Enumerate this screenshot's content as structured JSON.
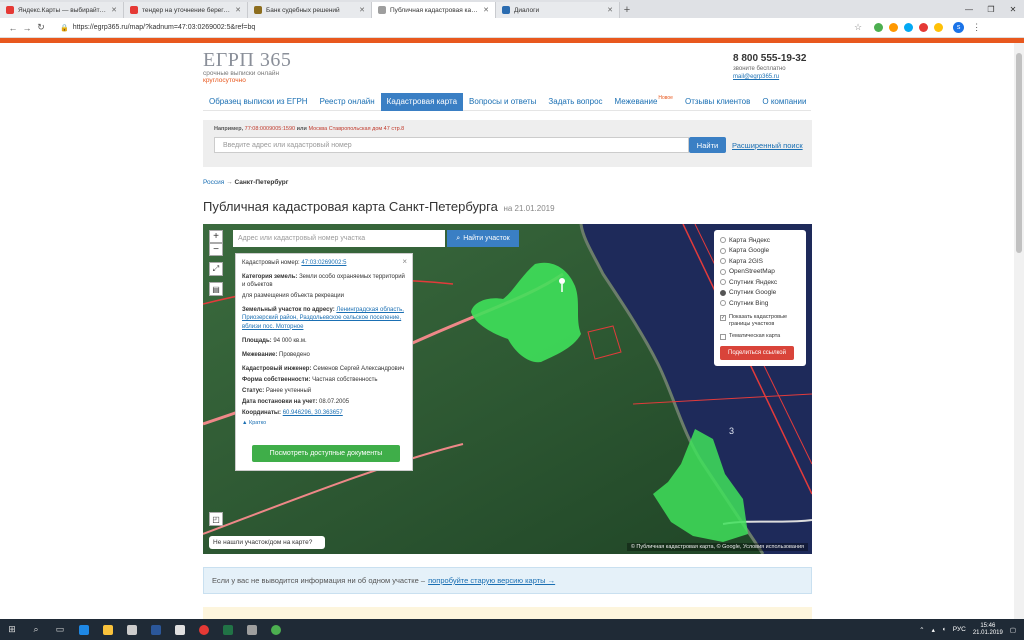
{
  "browser": {
    "tabs": [
      {
        "label": "Яндекс.Карты — выбирайте, где",
        "color": "#e53935",
        "active": false
      },
      {
        "label": "тендер на уточнение берегово",
        "color": "#e53935",
        "active": false
      },
      {
        "label": "Банк судебных решений",
        "color": "#8d6e1f",
        "active": false
      },
      {
        "label": "Публичная кадастровая карта",
        "color": "#9e9e9e",
        "active": true
      },
      {
        "label": "Диалоги",
        "color": "#2b6cb0",
        "active": false
      }
    ],
    "url": "https://egrp365.ru/map/?kadnum=47:03:0269002:5&ref=bq",
    "profile_initial": "s"
  },
  "header": {
    "logo_name": "ЕГРП 365",
    "logo_tag1": "срочные выписки онлайн",
    "logo_tag2": "круглосуточно",
    "phone": "8 800 555-19-32",
    "phone_note": "звоните бесплатно",
    "email": "mail@egrp365.ru"
  },
  "nav": {
    "items": [
      {
        "label": "Образец выписки из ЕГРН",
        "active": false,
        "badge": ""
      },
      {
        "label": "Реестр онлайн",
        "active": false,
        "badge": ""
      },
      {
        "label": "Кадастровая карта",
        "active": true,
        "badge": ""
      },
      {
        "label": "Вопросы и ответы",
        "active": false,
        "badge": ""
      },
      {
        "label": "Задать вопрос",
        "active": false,
        "badge": ""
      },
      {
        "label": "Межевание",
        "active": false,
        "badge": "Новое"
      },
      {
        "label": "Отзывы клиентов",
        "active": false,
        "badge": ""
      },
      {
        "label": "О компании",
        "active": false,
        "badge": ""
      }
    ]
  },
  "search": {
    "hint_prefix": "Например,",
    "hint_example1": "77:08:0009005:1590",
    "hint_or": "или",
    "hint_example2": "Москва Ставропольская дом 47 стр.8",
    "placeholder": "Введите адрес или кадастровый номер",
    "button": "Найти",
    "advanced": "Расширенный поиск"
  },
  "breadcrumb": {
    "root": "Россия",
    "sep": "→",
    "current": "Санкт-Петербург"
  },
  "page": {
    "title": "Публичная кадастровая карта Санкт-Петербурга",
    "date": "на 21.01.2019"
  },
  "map": {
    "search_placeholder": "Адрес или кадастровый номер участка",
    "search_button": "Найти участок",
    "zoom_in": "+",
    "zoom_out": "−",
    "not_found": "Не нашли участок/дом на карте?",
    "copyright": "© Публичная кадастровая карта, © Google, Условия использования",
    "label_3": "3",
    "info": {
      "cad_num_label": "Кадастровый номер:",
      "cad_num": "47:03:0269002:5",
      "category_label": "Категория земель:",
      "category": "Земли особо охраняемых территорий и объектов",
      "usage": "для размещения объекта рекреации",
      "address_label": "Земельный участок по адресу:",
      "address": "Ленинградская область, Приозерский район, Раздольевское сельское поселение, вблизи пос. Моторное",
      "area_label": "Площадь:",
      "area": "94 000 кв.м.",
      "survey_label": "Межевание:",
      "survey": "Проведено",
      "engineer_label": "Кадастровый инженер:",
      "engineer": "Семенов Сергей Александрович",
      "ownership_label": "Форма собственности:",
      "ownership": "Частная собственность",
      "status_label": "Статус:",
      "status": "Ранее учтенный",
      "reg_date_label": "Дата постановки на учет:",
      "reg_date": "08.07.2005",
      "coords_label": "Координаты:",
      "coords": "60.946296, 30.363657",
      "brief": "Кратко",
      "docs_button": "Посмотреть доступные документы"
    },
    "layers": {
      "options": [
        {
          "label": "Карта Яндекс",
          "selected": false
        },
        {
          "label": "Карта Google",
          "selected": false
        },
        {
          "label": "Карта 2GIS",
          "selected": false
        },
        {
          "label": "OpenStreetMap",
          "selected": false
        },
        {
          "label": "Спутник Яндекс",
          "selected": false
        },
        {
          "label": "Спутник Google",
          "selected": true
        },
        {
          "label": "Спутник Bing",
          "selected": false
        }
      ],
      "show_boundaries": "Показать кадастровые границы участков",
      "thematic": "Тематическая карта",
      "share": "Поделиться ссылкой"
    }
  },
  "infobar": {
    "text": "Если у вас не выводится информация ни об одном участке –",
    "link": "попробуйте старую версию карты →"
  },
  "taskbar": {
    "lang": "РУС",
    "time": "15:46",
    "date": "21.01.2019"
  },
  "colors": {
    "accent": "#3a7fc4",
    "brand_orange": "#e8581e",
    "parcel_green": "#3fe05a",
    "water": "#1e2a5a",
    "forest": "#2c5a32",
    "boundary_red": "#e23b3b"
  }
}
